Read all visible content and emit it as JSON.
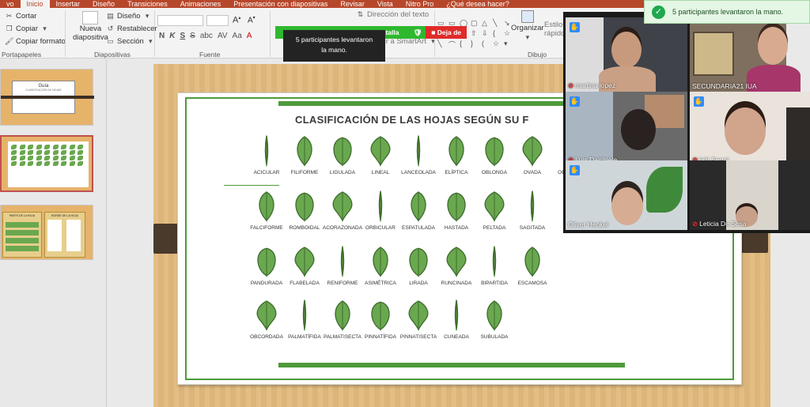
{
  "ribbon_tabs": [
    "vo",
    "Inicio",
    "Insertar",
    "Diseño",
    "Transiciones",
    "Animaciones",
    "Presentación con diapositivas",
    "Revisar",
    "Vista",
    "Nitro Pro",
    "¿Qué desea hacer?"
  ],
  "clipboard": {
    "cut": "Cortar",
    "copy": "Copiar",
    "format_painter": "Copiar formato",
    "group": "Portapapeles"
  },
  "slides_group": {
    "new_slide": "Nueva",
    "new_slide_2": "diapositiva",
    "layout": "Diseño",
    "reset": "Restablecer",
    "section": "Sección",
    "group": "Diapositivas"
  },
  "font_group": {
    "group": "Fuente",
    "bold": "N",
    "italic": "K",
    "underline": "S",
    "strike": "S"
  },
  "paragraph_group": {
    "text_direction": "Dirección del texto",
    "smartart": "tir a SmartArt"
  },
  "drawing_group": {
    "arrange": "Organizar",
    "quick_styles": "Estilos",
    "quick_styles_2": "rápidos",
    "group": "Dibujo"
  },
  "screen_share": {
    "banner": "Está compartiendo la pantalla",
    "stop": "Deja de"
  },
  "tooltip": {
    "line1": "5 participantes levantaron",
    "line2": "la mano."
  },
  "thumbnail1": {
    "title": "Guía",
    "subtitle": "CLASIFICACIÓN DE HOJAS"
  },
  "thumbnail3": {
    "label_left": "PARTE DE LA HOJA",
    "label_right": "BORDE DE LA HOJA"
  },
  "slide_title": "CLASIFICACIÓN DE LAS HOJAS SEGÚN SU F",
  "leaf_rows": [
    [
      "ACICULAR",
      "FILIFORME",
      "LIGULADA",
      "LINEAL",
      "LANCEOLADA",
      "ELÍPTICA",
      "OBLONGA",
      "OVADA",
      "OBOVADA"
    ],
    [
      "FALCIFORME",
      "ROMBOIDAL",
      "ACORAZONADA",
      "ORBICULAR",
      "ESPATULADA",
      "HASTADA",
      "PELTADA",
      "SAGITADA"
    ],
    [
      "PANDURADA",
      "FLABELADA",
      "RENIFORME",
      "ASIMÉTRICA",
      "LIRADA",
      "RUNCINADA",
      "BIPARTIDA",
      "ESCAMOSA"
    ],
    [
      "OBCORDADA",
      "PALMATÍFIDA",
      "PALMATISECTA",
      "PINNATÍFIDA",
      "PINNATISECTA",
      "CUNEADA",
      "SUBULADA"
    ]
  ],
  "participants": [
    "martina lopez",
    "SECUNDARIA21 IUA",
    "Luis Dalchiele",
    "lalit Segal",
    "Oliver Henkel",
    "Leticia De Sosa"
  ],
  "notification": "5 participantes levantaron la mano.",
  "colors": {
    "accent": "#b7472a",
    "leaf_green": "#6aa84f",
    "banner_green": "#2eb82e",
    "stop_red": "#e02b2b",
    "zoom_blue": "#2d8cff"
  }
}
